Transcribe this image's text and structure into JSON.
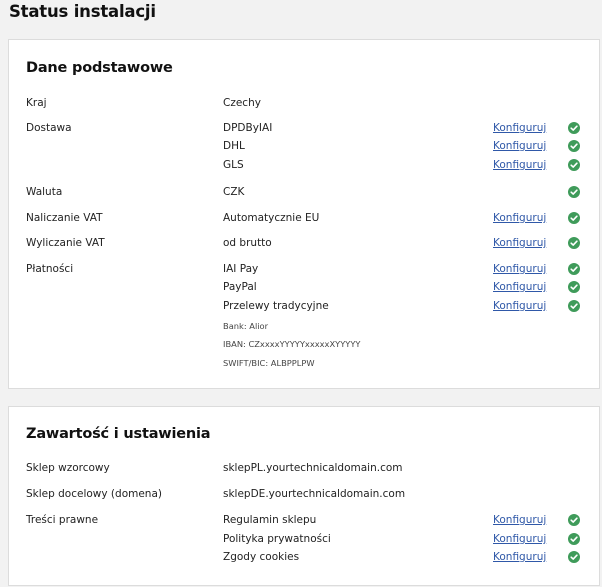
{
  "page": {
    "title": "Status instalacji"
  },
  "basic": {
    "title": "Dane podstawowe",
    "rows": [
      {
        "label": "Kraj",
        "value": "Czechy"
      },
      {
        "label": "Dostawa",
        "value": "DPDByIAI",
        "link": "Konfiguruj",
        "status": "ok"
      },
      {
        "value": "DHL",
        "link": "Konfiguruj",
        "status": "ok"
      },
      {
        "value": "GLS",
        "link": "Konfiguruj",
        "status": "ok"
      },
      {
        "label": "Waluta",
        "value": "CZK",
        "status": "ok"
      },
      {
        "label": "Naliczanie VAT",
        "value": "Automatycznie EU",
        "link": "Konfiguruj",
        "status": "ok"
      },
      {
        "label": "Wyliczanie VAT",
        "value": "od brutto",
        "link": "Konfiguruj",
        "status": "ok"
      },
      {
        "label": "Płatności",
        "value": "IAI Pay",
        "link": "Konfiguruj",
        "status": "ok"
      },
      {
        "value": "PayPal",
        "link": "Konfiguruj",
        "status": "ok"
      },
      {
        "value": "Przelewy tradycyjne",
        "link": "Konfiguruj",
        "status": "ok"
      },
      {
        "value": "Bank: Alior"
      },
      {
        "value": "IBAN: CZxxxxYYYYYxxxxxXYYYYY"
      },
      {
        "value": "SWIFT/BIC: ALBPPLPW"
      }
    ]
  },
  "content": {
    "title": "Zawartość i ustawienia",
    "rows": [
      {
        "label": "Sklep wzorcowy",
        "value": "sklepPL.yourtechnicaldomain.com"
      },
      {
        "label": "Sklep docelowy (domena)",
        "value": "sklepDE.yourtechnicaldomain.com"
      },
      {
        "label": "Treści prawne",
        "value": "Regulamin sklepu",
        "link": "Konfiguruj",
        "status": "ok"
      },
      {
        "value": "Polityka prywatności",
        "link": "Konfiguruj",
        "status": "ok"
      },
      {
        "value": "Zgody cookies",
        "link": "Konfiguruj",
        "status": "ok"
      }
    ]
  },
  "colors": {
    "link": "#2f58a8",
    "ok": "#3f9b5a",
    "panel_border": "#dcdcdc",
    "background": "#f2f2f2"
  },
  "icons": {
    "status_ok": "check-circle-icon"
  }
}
